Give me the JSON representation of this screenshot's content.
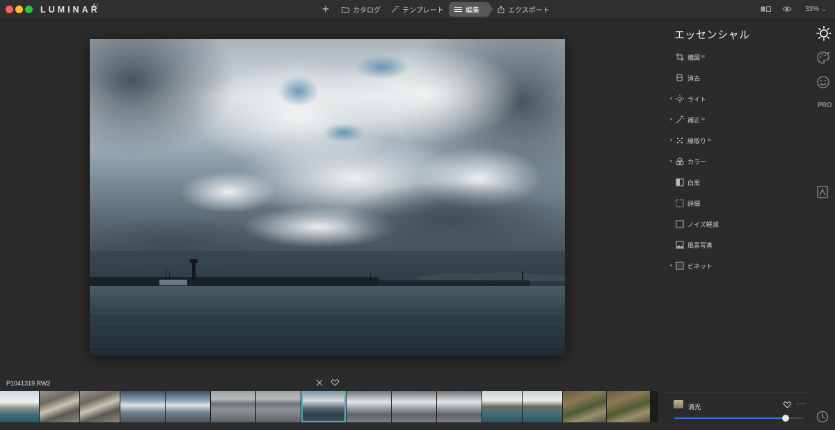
{
  "app": {
    "brand": "LUMINAR",
    "brand_sup": "AI"
  },
  "nav": {
    "add": "+",
    "catalog": "カタログ",
    "template": "テンプレート",
    "edit": "編集",
    "export": "エクスポート"
  },
  "view": {
    "zoom": "33%"
  },
  "panel": {
    "title": "エッセンシャル",
    "tools": [
      {
        "label": "構図",
        "ai": "AI",
        "icon": "crop-icon",
        "dot": false
      },
      {
        "label": "消去",
        "ai": "",
        "icon": "eraser-icon",
        "dot": false
      },
      {
        "label": "ライト",
        "ai": "",
        "icon": "sun-icon",
        "dot": true
      },
      {
        "label": "補正",
        "ai": "AI",
        "icon": "magic-wand-icon",
        "dot": true
      },
      {
        "label": "縁取り",
        "ai": "AI",
        "icon": "structure-icon",
        "dot": true
      },
      {
        "label": "カラー",
        "ai": "",
        "icon": "color-circles-icon",
        "dot": true
      },
      {
        "label": "白黒",
        "ai": "",
        "icon": "black-white-icon",
        "dot": false
      },
      {
        "label": "詳細",
        "ai": "",
        "icon": "details-icon",
        "dot": false
      },
      {
        "label": "ノイズ軽減",
        "ai": "",
        "icon": "noise-icon",
        "dot": false
      },
      {
        "label": "風景写真",
        "ai": "",
        "icon": "landscape-icon",
        "dot": false
      },
      {
        "label": "ビネット",
        "ai": "",
        "icon": "vignette-icon",
        "dot": true
      }
    ],
    "side_pro": "PRO"
  },
  "image": {
    "filename": "P1041319.RW2"
  },
  "filmstrip": {
    "selected_index": 7,
    "thumbs": [
      {
        "kind": "harbor-town",
        "width": 56
      },
      {
        "kind": "scrap-yard",
        "width": 57
      },
      {
        "kind": "scrap-yard",
        "width": 57
      },
      {
        "kind": "storm-sky",
        "width": 64
      },
      {
        "kind": "storm-sky",
        "width": 64
      },
      {
        "kind": "grey-sea",
        "width": 64
      },
      {
        "kind": "grey-sea",
        "width": 64
      },
      {
        "kind": "storm-sea-selected",
        "width": 64
      },
      {
        "kind": "cloud-sea",
        "width": 64
      },
      {
        "kind": "cloud-sea",
        "width": 64
      },
      {
        "kind": "cloud-sea",
        "width": 64
      },
      {
        "kind": "harbor-boats",
        "width": 57
      },
      {
        "kind": "harbor-boats",
        "width": 57
      },
      {
        "kind": "ivy-house",
        "width": 62
      },
      {
        "kind": "ivy-house",
        "width": 62
      }
    ]
  },
  "preset": {
    "name": "清光",
    "more": "···",
    "amount": 0.86
  },
  "colors": {
    "accent": "#3d6fe0",
    "selection": "#4fb3c8"
  }
}
